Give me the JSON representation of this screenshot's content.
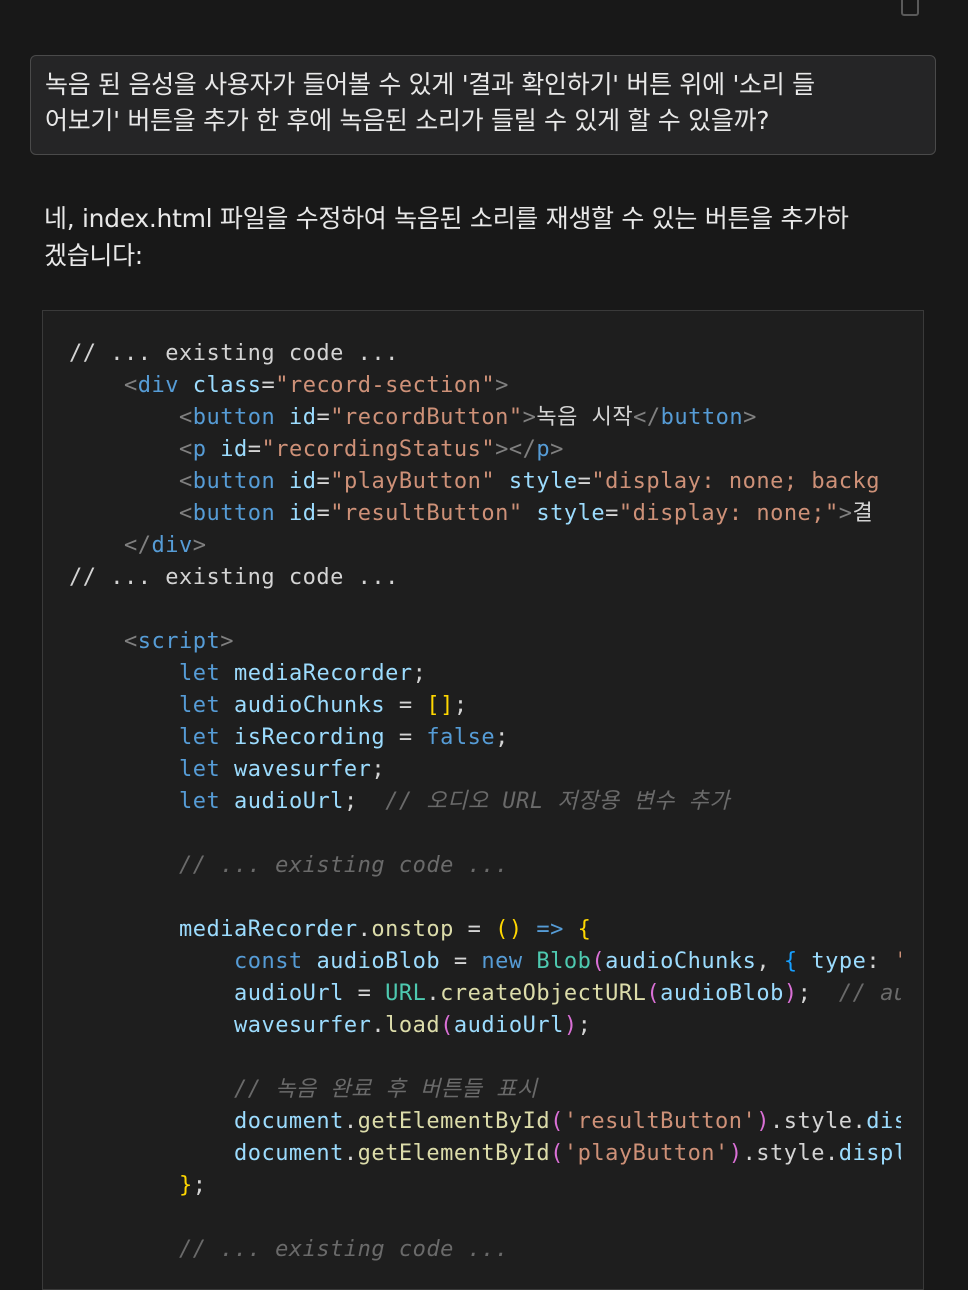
{
  "icons": {
    "copy": "copy-icon"
  },
  "user_message": {
    "line1": "녹음 된 음성을 사용자가 들어볼 수 있게 '결과 확인하기' 버튼 위에 '소리 들",
    "line2": "어보기' 버튼을 추가 한 후에 녹음된 소리가 들릴 수 있게 할 수 있을까?"
  },
  "assistant_message": {
    "line1": "네, index.html 파일을 수정하여 녹음된 소리를 재생할 수 있는 버튼을 추가하",
    "line2": "겠습니다:"
  },
  "colors": {
    "background": "#181818",
    "code_background": "#1e1e1e",
    "keyword": "#569cd6",
    "variable": "#9cdcfe",
    "string": "#ce9178",
    "function": "#dcdcaa",
    "class": "#4ec9b0",
    "comment": "#6a6a6a"
  },
  "code": {
    "lines": [
      [
        [
          "t-cmt-plain",
          "// ... existing code ..."
        ]
      ],
      [
        [
          "t-plain",
          "    "
        ],
        [
          "t-punc",
          "<"
        ],
        [
          "t-tag",
          "div"
        ],
        [
          "t-plain",
          " "
        ],
        [
          "t-attr",
          "class"
        ],
        [
          "t-plain",
          "="
        ],
        [
          "t-str",
          "\"record-section\""
        ],
        [
          "t-punc",
          ">"
        ]
      ],
      [
        [
          "t-plain",
          "        "
        ],
        [
          "t-punc",
          "<"
        ],
        [
          "t-tag",
          "button"
        ],
        [
          "t-plain",
          " "
        ],
        [
          "t-attr",
          "id"
        ],
        [
          "t-plain",
          "="
        ],
        [
          "t-str",
          "\"recordButton\""
        ],
        [
          "t-punc",
          ">"
        ],
        [
          "t-plain",
          "녹음 시작"
        ],
        [
          "t-punc",
          "</"
        ],
        [
          "t-tag",
          "button"
        ],
        [
          "t-punc",
          ">"
        ]
      ],
      [
        [
          "t-plain",
          "        "
        ],
        [
          "t-punc",
          "<"
        ],
        [
          "t-tag",
          "p"
        ],
        [
          "t-plain",
          " "
        ],
        [
          "t-attr",
          "id"
        ],
        [
          "t-plain",
          "="
        ],
        [
          "t-str",
          "\"recordingStatus\""
        ],
        [
          "t-punc",
          "></"
        ],
        [
          "t-tag",
          "p"
        ],
        [
          "t-punc",
          ">"
        ]
      ],
      [
        [
          "t-plain",
          "        "
        ],
        [
          "t-punc",
          "<"
        ],
        [
          "t-tag",
          "button"
        ],
        [
          "t-plain",
          " "
        ],
        [
          "t-attr",
          "id"
        ],
        [
          "t-plain",
          "="
        ],
        [
          "t-str",
          "\"playButton\""
        ],
        [
          "t-plain",
          " "
        ],
        [
          "t-attr",
          "style"
        ],
        [
          "t-plain",
          "="
        ],
        [
          "t-str",
          "\"display: none; backg"
        ]
      ],
      [
        [
          "t-plain",
          "        "
        ],
        [
          "t-punc",
          "<"
        ],
        [
          "t-tag",
          "button"
        ],
        [
          "t-plain",
          " "
        ],
        [
          "t-attr",
          "id"
        ],
        [
          "t-plain",
          "="
        ],
        [
          "t-str",
          "\"resultButton\""
        ],
        [
          "t-plain",
          " "
        ],
        [
          "t-attr",
          "style"
        ],
        [
          "t-plain",
          "="
        ],
        [
          "t-str",
          "\"display: none;\""
        ],
        [
          "t-punc",
          ">"
        ],
        [
          "t-plain",
          "결"
        ]
      ],
      [
        [
          "t-plain",
          "    "
        ],
        [
          "t-punc",
          "</"
        ],
        [
          "t-tag",
          "div"
        ],
        [
          "t-punc",
          ">"
        ]
      ],
      [
        [
          "t-cmt-plain",
          "// ... existing code ..."
        ]
      ],
      [],
      [
        [
          "t-plain",
          "    "
        ],
        [
          "t-punc",
          "<"
        ],
        [
          "t-tag",
          "script"
        ],
        [
          "t-punc",
          ">"
        ]
      ],
      [
        [
          "t-plain",
          "        "
        ],
        [
          "t-kw",
          "let"
        ],
        [
          "t-plain",
          " "
        ],
        [
          "t-var",
          "mediaRecorder"
        ],
        [
          "t-plain",
          ";"
        ]
      ],
      [
        [
          "t-plain",
          "        "
        ],
        [
          "t-kw",
          "let"
        ],
        [
          "t-plain",
          " "
        ],
        [
          "t-var",
          "audioChunks"
        ],
        [
          "t-plain",
          " = "
        ],
        [
          "t-br",
          "[]"
        ],
        [
          "t-plain",
          ";"
        ]
      ],
      [
        [
          "t-plain",
          "        "
        ],
        [
          "t-kw",
          "let"
        ],
        [
          "t-plain",
          " "
        ],
        [
          "t-var",
          "isRecording"
        ],
        [
          "t-plain",
          " = "
        ],
        [
          "t-kw",
          "false"
        ],
        [
          "t-plain",
          ";"
        ]
      ],
      [
        [
          "t-plain",
          "        "
        ],
        [
          "t-kw",
          "let"
        ],
        [
          "t-plain",
          " "
        ],
        [
          "t-var",
          "wavesurfer"
        ],
        [
          "t-plain",
          ";"
        ]
      ],
      [
        [
          "t-plain",
          "        "
        ],
        [
          "t-kw",
          "let"
        ],
        [
          "t-plain",
          " "
        ],
        [
          "t-var",
          "audioUrl"
        ],
        [
          "t-plain",
          ";  "
        ],
        [
          "t-cmt",
          "// 오디오 URL 저장용 변수 추가"
        ]
      ],
      [],
      [
        [
          "t-plain",
          "        "
        ],
        [
          "t-cmt",
          "// ... existing code ..."
        ]
      ],
      [],
      [
        [
          "t-plain",
          "        "
        ],
        [
          "t-var",
          "mediaRecorder"
        ],
        [
          "t-plain",
          "."
        ],
        [
          "t-fn",
          "onstop"
        ],
        [
          "t-plain",
          " = "
        ],
        [
          "t-br",
          "()"
        ],
        [
          "t-plain",
          " "
        ],
        [
          "t-kw",
          "=>"
        ],
        [
          "t-plain",
          " "
        ],
        [
          "t-br",
          "{"
        ]
      ],
      [
        [
          "t-plain",
          "            "
        ],
        [
          "t-kw",
          "const"
        ],
        [
          "t-plain",
          " "
        ],
        [
          "t-var",
          "audioBlob"
        ],
        [
          "t-plain",
          " = "
        ],
        [
          "t-kw",
          "new"
        ],
        [
          "t-plain",
          " "
        ],
        [
          "t-cls",
          "Blob"
        ],
        [
          "t-br2",
          "("
        ],
        [
          "t-var",
          "audioChunks"
        ],
        [
          "t-plain",
          ", "
        ],
        [
          "t-br3",
          "{"
        ],
        [
          "t-plain",
          " "
        ],
        [
          "t-var",
          "type"
        ],
        [
          "t-plain",
          ": "
        ],
        [
          "t-str",
          "'au"
        ]
      ],
      [
        [
          "t-plain",
          "            "
        ],
        [
          "t-var",
          "audioUrl"
        ],
        [
          "t-plain",
          " = "
        ],
        [
          "t-cls",
          "URL"
        ],
        [
          "t-plain",
          "."
        ],
        [
          "t-fn",
          "createObjectURL"
        ],
        [
          "t-br2",
          "("
        ],
        [
          "t-var",
          "audioBlob"
        ],
        [
          "t-br2",
          ")"
        ],
        [
          "t-plain",
          ";  "
        ],
        [
          "t-cmt",
          "// audi"
        ]
      ],
      [
        [
          "t-plain",
          "            "
        ],
        [
          "t-var",
          "wavesurfer"
        ],
        [
          "t-plain",
          "."
        ],
        [
          "t-fn",
          "load"
        ],
        [
          "t-br2",
          "("
        ],
        [
          "t-var",
          "audioUrl"
        ],
        [
          "t-br2",
          ")"
        ],
        [
          "t-plain",
          ";"
        ]
      ],
      [],
      [
        [
          "t-plain",
          "            "
        ],
        [
          "t-cmt",
          "// 녹음 완료 후 버튼들 표시"
        ]
      ],
      [
        [
          "t-plain",
          "            "
        ],
        [
          "t-var",
          "document"
        ],
        [
          "t-plain",
          "."
        ],
        [
          "t-fn",
          "getElementById"
        ],
        [
          "t-br2",
          "("
        ],
        [
          "t-str",
          "'resultButton'"
        ],
        [
          "t-br2",
          ")"
        ],
        [
          "t-plain",
          ".style."
        ],
        [
          "t-var",
          "displ"
        ]
      ],
      [
        [
          "t-plain",
          "            "
        ],
        [
          "t-var",
          "document"
        ],
        [
          "t-plain",
          "."
        ],
        [
          "t-fn",
          "getElementById"
        ],
        [
          "t-br2",
          "("
        ],
        [
          "t-str",
          "'playButton'"
        ],
        [
          "t-br2",
          ")"
        ],
        [
          "t-plain",
          ".style."
        ],
        [
          "t-var",
          "display"
        ]
      ],
      [
        [
          "t-plain",
          "        "
        ],
        [
          "t-br",
          "}"
        ],
        [
          "t-plain",
          ";"
        ]
      ],
      [],
      [
        [
          "t-plain",
          "        "
        ],
        [
          "t-cmt",
          "// ... existing code ..."
        ]
      ]
    ]
  }
}
